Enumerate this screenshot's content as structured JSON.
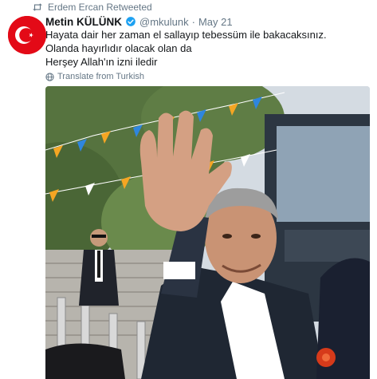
{
  "retweet_context": {
    "text": "Erdem Ercan Retweeted",
    "icon": "retweet-icon"
  },
  "author": {
    "name": "Metin KÜLÜNK",
    "handle": "@mkulunk",
    "separator": "·",
    "date": "May 21",
    "verified": true,
    "avatar_icon": "turkish-flag-avatar"
  },
  "tweet": {
    "lines": [
      "Hayata dair her zaman el sallayıp tebessüm ile bakacaksınız.",
      "Olanda hayırlıdır olacak olan da",
      "Herşey Allah'ın izni iledir"
    ]
  },
  "translate": {
    "label": "Translate from Turkish",
    "icon": "globe-icon"
  },
  "media": {
    "type": "photo"
  },
  "colors": {
    "name": "#14171a",
    "secondary": "#657786",
    "verified": "#1da1f2",
    "avatar_red": "#e30a17"
  }
}
